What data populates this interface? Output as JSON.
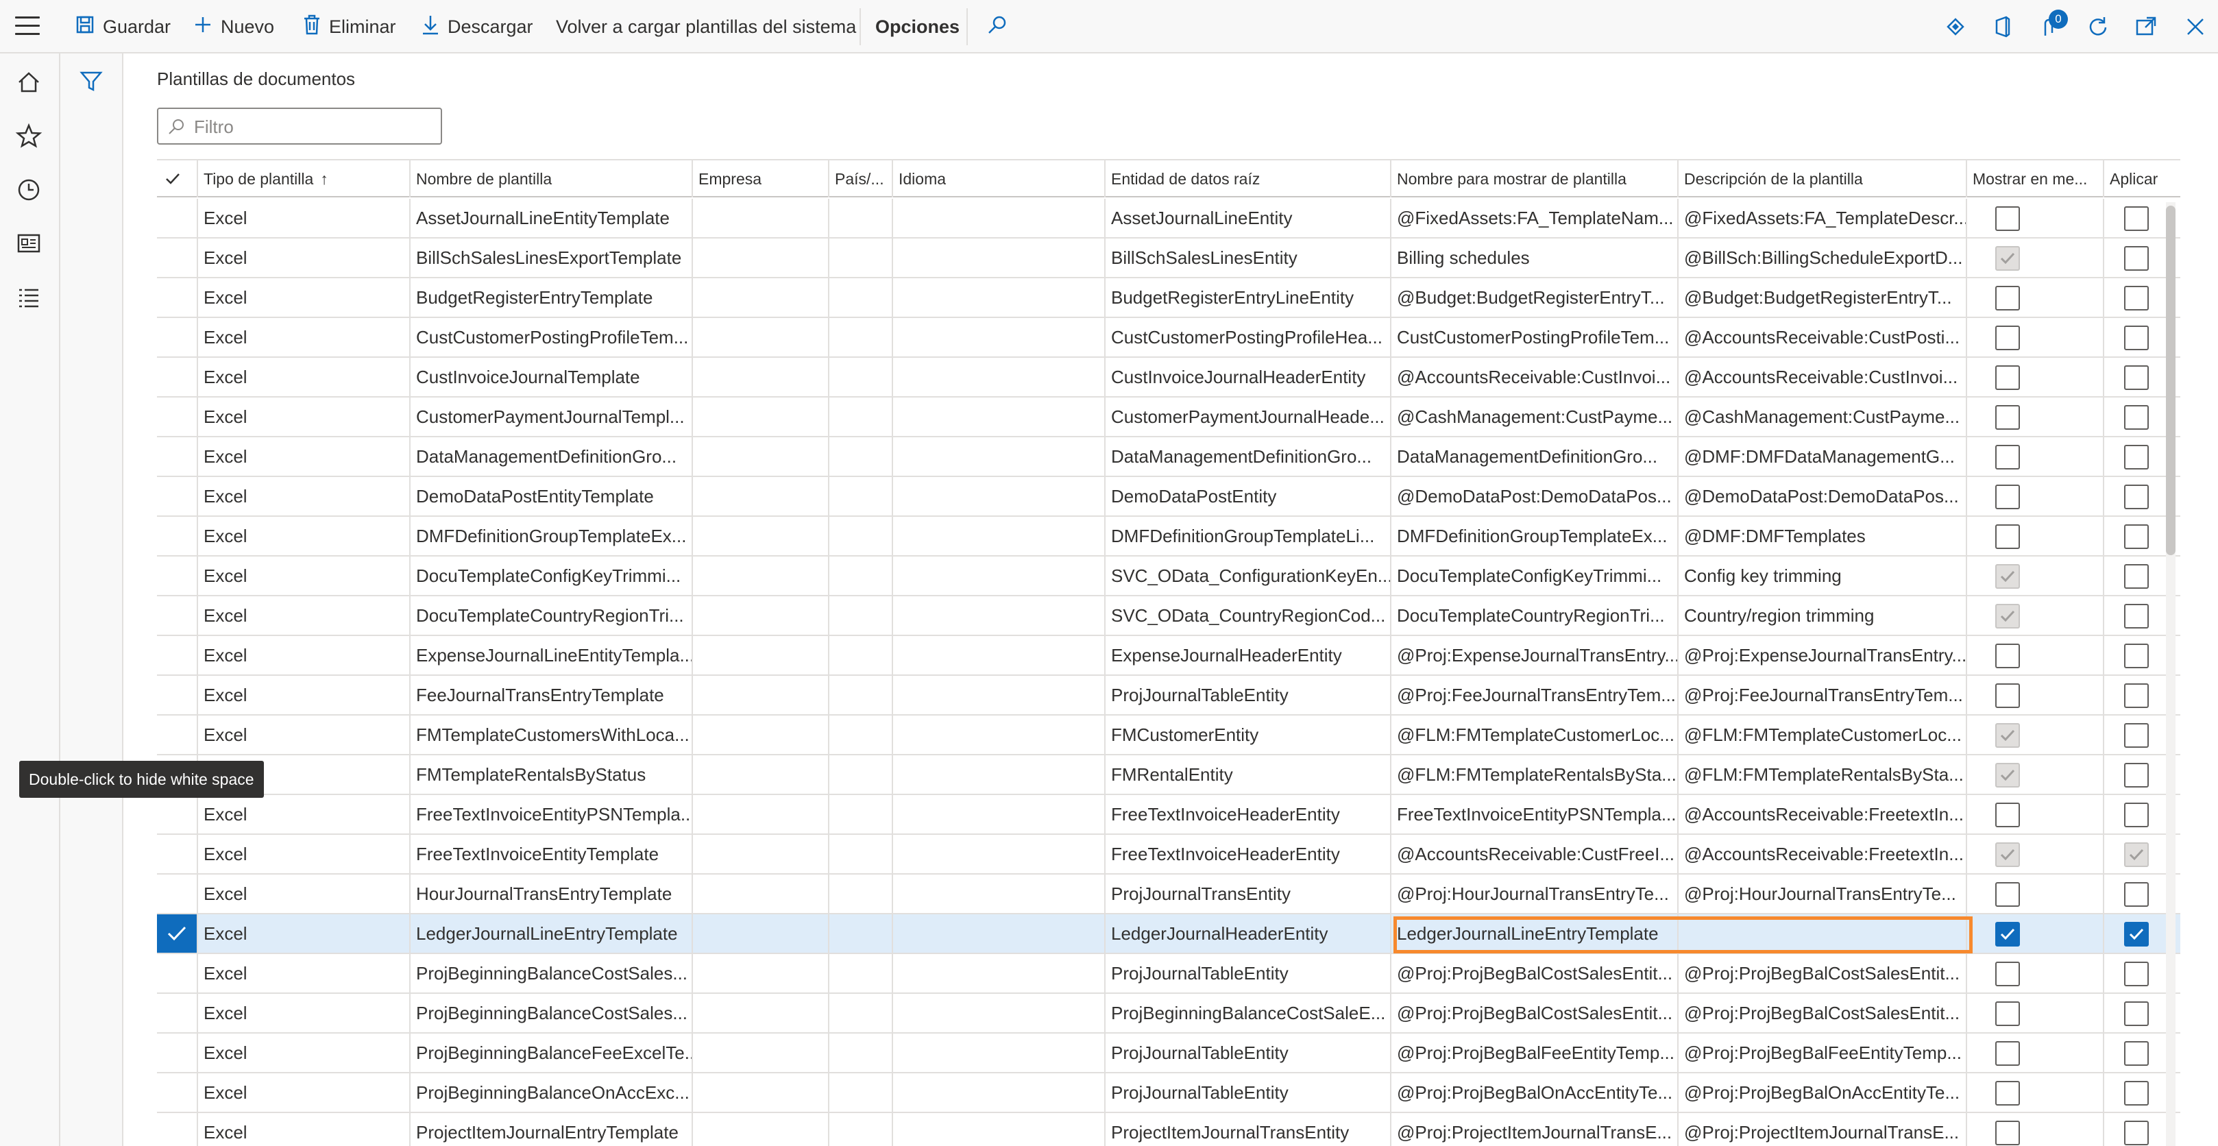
{
  "toolbar": {
    "save": "Guardar",
    "new": "Nuevo",
    "delete": "Eliminar",
    "download": "Descargar",
    "reload": "Volver a cargar plantillas del sistema",
    "options": "Opciones",
    "notifications_count": "0"
  },
  "page": {
    "title": "Plantillas de documentos",
    "filter_placeholder": "Filtro"
  },
  "columns": {
    "tipo": "Tipo de plantilla",
    "sort_arrow": "↑",
    "nombre": "Nombre de plantilla",
    "empresa": "Empresa",
    "pais": "País/...",
    "idioma": "Idioma",
    "entidad": "Entidad de datos raíz",
    "mostrar_nombre": "Nombre para mostrar de plantilla",
    "descripcion": "Descripción de la plantilla",
    "mostrar_menu": "Mostrar en me...",
    "aplicar": "Aplicar"
  },
  "rows": [
    {
      "tipo": "Excel",
      "nombre": "AssetJournalLineEntityTemplate",
      "entidad": "AssetJournalLineEntity",
      "mostrar": "@FixedAssets:FA_TemplateNam...",
      "desc": "@FixedAssets:FA_TemplateDescr...",
      "menu": "off",
      "aplicar": "off",
      "selected": false
    },
    {
      "tipo": "Excel",
      "nombre": "BillSchSalesLinesExportTemplate",
      "entidad": "BillSchSalesLinesEntity",
      "mostrar": "Billing schedules",
      "desc": "@BillSch:BillingScheduleExportD...",
      "menu": "disabled",
      "aplicar": "off",
      "selected": false
    },
    {
      "tipo": "Excel",
      "nombre": "BudgetRegisterEntryTemplate",
      "entidad": "BudgetRegisterEntryLineEntity",
      "mostrar": "@Budget:BudgetRegisterEntryT...",
      "desc": "@Budget:BudgetRegisterEntryT...",
      "menu": "off",
      "aplicar": "off",
      "selected": false
    },
    {
      "tipo": "Excel",
      "nombre": "CustCustomerPostingProfileTem...",
      "entidad": "CustCustomerPostingProfileHea...",
      "mostrar": "CustCustomerPostingProfileTem...",
      "desc": "@AccountsReceivable:CustPosti...",
      "menu": "off",
      "aplicar": "off",
      "selected": false
    },
    {
      "tipo": "Excel",
      "nombre": "CustInvoiceJournalTemplate",
      "entidad": "CustInvoiceJournalHeaderEntity",
      "mostrar": "@AccountsReceivable:CustInvoi...",
      "desc": "@AccountsReceivable:CustInvoi...",
      "menu": "off",
      "aplicar": "off",
      "selected": false
    },
    {
      "tipo": "Excel",
      "nombre": "CustomerPaymentJournalTempl...",
      "entidad": "CustomerPaymentJournalHeade...",
      "mostrar": "@CashManagement:CustPayme...",
      "desc": "@CashManagement:CustPayme...",
      "menu": "off",
      "aplicar": "off",
      "selected": false
    },
    {
      "tipo": "Excel",
      "nombre": "DataManagementDefinitionGro...",
      "entidad": "DataManagementDefinitionGro...",
      "mostrar": "DataManagementDefinitionGro...",
      "desc": "@DMF:DMFDataManagementG...",
      "menu": "off",
      "aplicar": "off",
      "selected": false
    },
    {
      "tipo": "Excel",
      "nombre": "DemoDataPostEntityTemplate",
      "entidad": "DemoDataPostEntity",
      "mostrar": "@DemoDataPost:DemoDataPos...",
      "desc": "@DemoDataPost:DemoDataPos...",
      "menu": "off",
      "aplicar": "off",
      "selected": false
    },
    {
      "tipo": "Excel",
      "nombre": "DMFDefinitionGroupTemplateEx...",
      "entidad": "DMFDefinitionGroupTemplateLi...",
      "mostrar": "DMFDefinitionGroupTemplateEx...",
      "desc": "@DMF:DMFTemplates",
      "menu": "off",
      "aplicar": "off",
      "selected": false
    },
    {
      "tipo": "Excel",
      "nombre": "DocuTemplateConfigKeyTrimmi...",
      "entidad": "SVC_OData_ConfigurationKeyEn...",
      "mostrar": "DocuTemplateConfigKeyTrimmi...",
      "desc": "Config key trimming",
      "menu": "disabled",
      "aplicar": "off",
      "selected": false
    },
    {
      "tipo": "Excel",
      "nombre": "DocuTemplateCountryRegionTri...",
      "entidad": "SVC_OData_CountryRegionCod...",
      "mostrar": "DocuTemplateCountryRegionTri...",
      "desc": "Country/region trimming",
      "menu": "disabled",
      "aplicar": "off",
      "selected": false
    },
    {
      "tipo": "Excel",
      "nombre": "ExpenseJournalLineEntityTempla...",
      "entidad": "ExpenseJournalHeaderEntity",
      "mostrar": "@Proj:ExpenseJournalTransEntry...",
      "desc": "@Proj:ExpenseJournalTransEntry...",
      "menu": "off",
      "aplicar": "off",
      "selected": false
    },
    {
      "tipo": "Excel",
      "nombre": "FeeJournalTransEntryTemplate",
      "entidad": "ProjJournalTableEntity",
      "mostrar": "@Proj:FeeJournalTransEntryTem...",
      "desc": "@Proj:FeeJournalTransEntryTem...",
      "menu": "off",
      "aplicar": "off",
      "selected": false
    },
    {
      "tipo": "Excel",
      "nombre": "FMTemplateCustomersWithLoca...",
      "entidad": "FMCustomerEntity",
      "mostrar": "@FLM:FMTemplateCustomerLoc...",
      "desc": "@FLM:FMTemplateCustomerLoc...",
      "menu": "disabled",
      "aplicar": "off",
      "selected": false
    },
    {
      "tipo": "Excel",
      "nombre": "FMTemplateRentalsByStatus",
      "entidad": "FMRentalEntity",
      "mostrar": "@FLM:FMTemplateRentalsBySta...",
      "desc": "@FLM:FMTemplateRentalsBySta...",
      "menu": "disabled",
      "aplicar": "off",
      "selected": false
    },
    {
      "tipo": "Excel",
      "nombre": "FreeTextInvoiceEntityPSNTempla...",
      "entidad": "FreeTextInvoiceHeaderEntity",
      "mostrar": "FreeTextInvoiceEntityPSNTempla...",
      "desc": "@AccountsReceivable:FreetextIn...",
      "menu": "off",
      "aplicar": "off",
      "selected": false
    },
    {
      "tipo": "Excel",
      "nombre": "FreeTextInvoiceEntityTemplate",
      "entidad": "FreeTextInvoiceHeaderEntity",
      "mostrar": "@AccountsReceivable:CustFreeI...",
      "desc": "@AccountsReceivable:FreetextIn...",
      "menu": "disabled",
      "aplicar": "disabled",
      "selected": false
    },
    {
      "tipo": "Excel",
      "nombre": "HourJournalTransEntryTemplate",
      "entidad": "ProjJournalTransEntity",
      "mostrar": "@Proj:HourJournalTransEntryTe...",
      "desc": "@Proj:HourJournalTransEntryTe...",
      "menu": "off",
      "aplicar": "off",
      "selected": false
    },
    {
      "tipo": "Excel",
      "nombre": "LedgerJournalLineEntryTemplate",
      "entidad": "LedgerJournalHeaderEntity",
      "mostrar": "LedgerJournalLineEntryTemplate",
      "desc": "",
      "menu": "checked",
      "aplicar": "checked",
      "selected": true
    },
    {
      "tipo": "Excel",
      "nombre": "ProjBeginningBalanceCostSales...",
      "entidad": "ProjJournalTableEntity",
      "mostrar": "@Proj:ProjBegBalCostSalesEntit...",
      "desc": "@Proj:ProjBegBalCostSalesEntit...",
      "menu": "off",
      "aplicar": "off",
      "selected": false
    },
    {
      "tipo": "Excel",
      "nombre": "ProjBeginningBalanceCostSales...",
      "entidad": "ProjBeginningBalanceCostSaleE...",
      "mostrar": "@Proj:ProjBegBalCostSalesEntit...",
      "desc": "@Proj:ProjBegBalCostSalesEntit...",
      "menu": "off",
      "aplicar": "off",
      "selected": false
    },
    {
      "tipo": "Excel",
      "nombre": "ProjBeginningBalanceFeeExcelTe...",
      "entidad": "ProjJournalTableEntity",
      "mostrar": "@Proj:ProjBegBalFeeEntityTemp...",
      "desc": "@Proj:ProjBegBalFeeEntityTemp...",
      "menu": "off",
      "aplicar": "off",
      "selected": false
    },
    {
      "tipo": "Excel",
      "nombre": "ProjBeginningBalanceOnAccExc...",
      "entidad": "ProjJournalTableEntity",
      "mostrar": "@Proj:ProjBegBalOnAccEntityTe...",
      "desc": "@Proj:ProjBegBalOnAccEntityTe...",
      "menu": "off",
      "aplicar": "off",
      "selected": false
    },
    {
      "tipo": "Excel",
      "nombre": "ProjectItemJournalEntryTemplate",
      "entidad": "ProjectItemJournalTransEntity",
      "mostrar": "@Proj:ProjectItemJournalTransE...",
      "desc": "@Proj:ProjectItemJournalTransE...",
      "menu": "off",
      "aplicar": "off",
      "selected": false
    }
  ],
  "tooltip": "Double-click to hide white space",
  "colors": {
    "accent": "#0f6cbd",
    "highlight": "#f7892d",
    "selected_row": "#deecf9"
  }
}
